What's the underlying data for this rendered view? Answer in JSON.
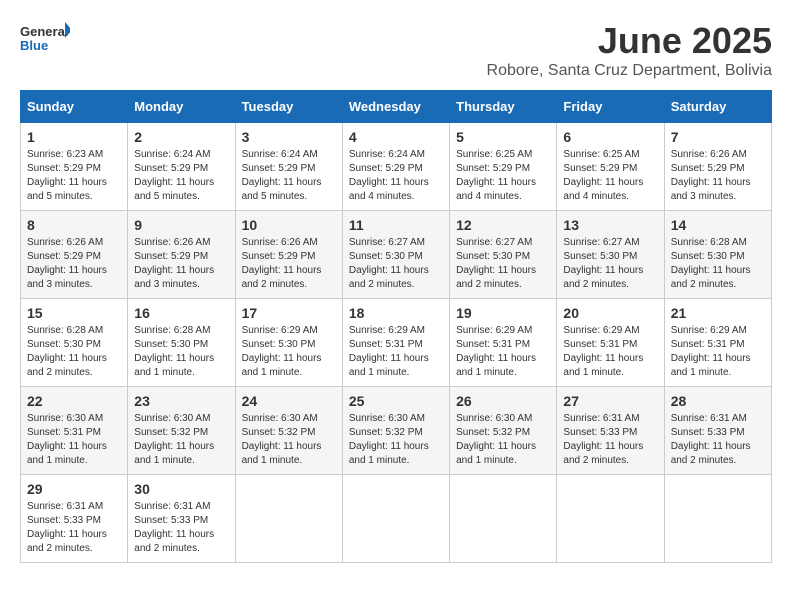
{
  "logo": {
    "general": "General",
    "blue": "Blue"
  },
  "title": "June 2025",
  "location": "Robore, Santa Cruz Department, Bolivia",
  "weekdays": [
    "Sunday",
    "Monday",
    "Tuesday",
    "Wednesday",
    "Thursday",
    "Friday",
    "Saturday"
  ],
  "weeks": [
    [
      {
        "day": "1",
        "sunrise": "6:23 AM",
        "sunset": "5:29 PM",
        "daylight": "11 hours and 5 minutes."
      },
      {
        "day": "2",
        "sunrise": "6:24 AM",
        "sunset": "5:29 PM",
        "daylight": "11 hours and 5 minutes."
      },
      {
        "day": "3",
        "sunrise": "6:24 AM",
        "sunset": "5:29 PM",
        "daylight": "11 hours and 5 minutes."
      },
      {
        "day": "4",
        "sunrise": "6:24 AM",
        "sunset": "5:29 PM",
        "daylight": "11 hours and 4 minutes."
      },
      {
        "day": "5",
        "sunrise": "6:25 AM",
        "sunset": "5:29 PM",
        "daylight": "11 hours and 4 minutes."
      },
      {
        "day": "6",
        "sunrise": "6:25 AM",
        "sunset": "5:29 PM",
        "daylight": "11 hours and 4 minutes."
      },
      {
        "day": "7",
        "sunrise": "6:26 AM",
        "sunset": "5:29 PM",
        "daylight": "11 hours and 3 minutes."
      }
    ],
    [
      {
        "day": "8",
        "sunrise": "6:26 AM",
        "sunset": "5:29 PM",
        "daylight": "11 hours and 3 minutes."
      },
      {
        "day": "9",
        "sunrise": "6:26 AM",
        "sunset": "5:29 PM",
        "daylight": "11 hours and 3 minutes."
      },
      {
        "day": "10",
        "sunrise": "6:26 AM",
        "sunset": "5:29 PM",
        "daylight": "11 hours and 2 minutes."
      },
      {
        "day": "11",
        "sunrise": "6:27 AM",
        "sunset": "5:30 PM",
        "daylight": "11 hours and 2 minutes."
      },
      {
        "day": "12",
        "sunrise": "6:27 AM",
        "sunset": "5:30 PM",
        "daylight": "11 hours and 2 minutes."
      },
      {
        "day": "13",
        "sunrise": "6:27 AM",
        "sunset": "5:30 PM",
        "daylight": "11 hours and 2 minutes."
      },
      {
        "day": "14",
        "sunrise": "6:28 AM",
        "sunset": "5:30 PM",
        "daylight": "11 hours and 2 minutes."
      }
    ],
    [
      {
        "day": "15",
        "sunrise": "6:28 AM",
        "sunset": "5:30 PM",
        "daylight": "11 hours and 2 minutes."
      },
      {
        "day": "16",
        "sunrise": "6:28 AM",
        "sunset": "5:30 PM",
        "daylight": "11 hours and 1 minute."
      },
      {
        "day": "17",
        "sunrise": "6:29 AM",
        "sunset": "5:30 PM",
        "daylight": "11 hours and 1 minute."
      },
      {
        "day": "18",
        "sunrise": "6:29 AM",
        "sunset": "5:31 PM",
        "daylight": "11 hours and 1 minute."
      },
      {
        "day": "19",
        "sunrise": "6:29 AM",
        "sunset": "5:31 PM",
        "daylight": "11 hours and 1 minute."
      },
      {
        "day": "20",
        "sunrise": "6:29 AM",
        "sunset": "5:31 PM",
        "daylight": "11 hours and 1 minute."
      },
      {
        "day": "21",
        "sunrise": "6:29 AM",
        "sunset": "5:31 PM",
        "daylight": "11 hours and 1 minute."
      }
    ],
    [
      {
        "day": "22",
        "sunrise": "6:30 AM",
        "sunset": "5:31 PM",
        "daylight": "11 hours and 1 minute."
      },
      {
        "day": "23",
        "sunrise": "6:30 AM",
        "sunset": "5:32 PM",
        "daylight": "11 hours and 1 minute."
      },
      {
        "day": "24",
        "sunrise": "6:30 AM",
        "sunset": "5:32 PM",
        "daylight": "11 hours and 1 minute."
      },
      {
        "day": "25",
        "sunrise": "6:30 AM",
        "sunset": "5:32 PM",
        "daylight": "11 hours and 1 minute."
      },
      {
        "day": "26",
        "sunrise": "6:30 AM",
        "sunset": "5:32 PM",
        "daylight": "11 hours and 1 minute."
      },
      {
        "day": "27",
        "sunrise": "6:31 AM",
        "sunset": "5:33 PM",
        "daylight": "11 hours and 2 minutes."
      },
      {
        "day": "28",
        "sunrise": "6:31 AM",
        "sunset": "5:33 PM",
        "daylight": "11 hours and 2 minutes."
      }
    ],
    [
      {
        "day": "29",
        "sunrise": "6:31 AM",
        "sunset": "5:33 PM",
        "daylight": "11 hours and 2 minutes."
      },
      {
        "day": "30",
        "sunrise": "6:31 AM",
        "sunset": "5:33 PM",
        "daylight": "11 hours and 2 minutes."
      },
      null,
      null,
      null,
      null,
      null
    ]
  ],
  "labels": {
    "sunrise": "Sunrise:",
    "sunset": "Sunset:",
    "daylight": "Daylight hours"
  }
}
